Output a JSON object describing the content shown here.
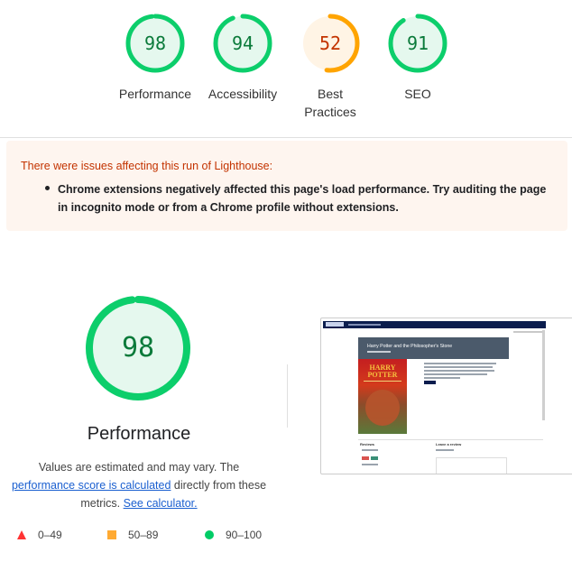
{
  "scores": [
    {
      "label": "Performance",
      "value": "98",
      "status": "pass",
      "fraction": 0.98
    },
    {
      "label": "Accessibility",
      "value": "94",
      "status": "pass",
      "fraction": 0.94
    },
    {
      "label": "Best Practices",
      "value": "52",
      "status": "average",
      "fraction": 0.52
    },
    {
      "label": "SEO",
      "value": "91",
      "status": "pass",
      "fraction": 0.91
    }
  ],
  "warning": {
    "title": "There were issues affecting this run of Lighthouse:",
    "items": [
      "Chrome extensions negatively affected this page's load performance. Try auditing the page in incognito mode or from a Chrome profile without extensions."
    ]
  },
  "performance": {
    "score": "98",
    "fraction": 0.98,
    "title": "Performance",
    "desc_text_1": "Values are estimated and may vary. The ",
    "desc_link_1": "performance score is calculated",
    "desc_text_2": " directly from these metrics. ",
    "desc_link_2": "See calculator."
  },
  "legend": [
    {
      "range": "0–49",
      "shape": "triangle",
      "color": "#ff3333"
    },
    {
      "range": "50–89",
      "shape": "square",
      "color": "#ffaa33"
    },
    {
      "range": "90–100",
      "shape": "circle",
      "color": "#00cc66"
    }
  ],
  "thumbnail": {
    "hero_title": "Harry Potter and the Philosopher's Stone",
    "book_title": "HARRY POTTER",
    "reviews_label": "Reviews",
    "leave_review_label": "Leave a review"
  },
  "colors": {
    "pass": "#0cce6b",
    "pass_bg": "#e5f8ee",
    "average": "#ffa400",
    "average_bg": "#fff4e5"
  }
}
